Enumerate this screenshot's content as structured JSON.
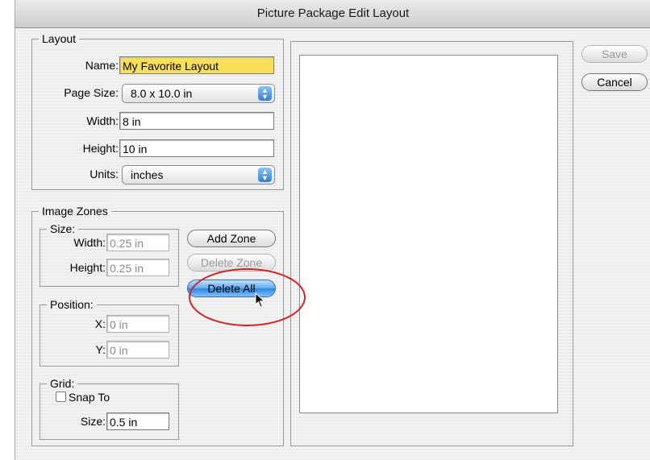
{
  "window": {
    "title": "Picture Package Edit Layout"
  },
  "layout_group": {
    "title": "Layout",
    "name_label": "Name:",
    "name_value": "My Favorite Layout",
    "page_size_label": "Page Size:",
    "page_size_value": "8.0 x 10.0 in",
    "width_label": "Width:",
    "width_value": "8 in",
    "height_label": "Height:",
    "height_value": "10 in",
    "units_label": "Units:",
    "units_value": "inches"
  },
  "image_zones": {
    "title": "Image Zones",
    "size_title": "Size:",
    "width_label": "Width:",
    "width_value": "0.25 in",
    "height_label": "Height:",
    "height_value": "0.25 in",
    "add_zone": "Add Zone",
    "delete_zone": "Delete Zone",
    "delete_all": "Delete All",
    "position_title": "Position:",
    "x_label": "X:",
    "x_value": "0 in",
    "y_label": "Y:",
    "y_value": "0 in",
    "grid_title": "Grid:",
    "snap_to": "Snap To",
    "grid_size_label": "Size:",
    "grid_size_value": "0.5 in"
  },
  "actions": {
    "save": "Save",
    "cancel": "Cancel"
  },
  "colors": {
    "highlight_field": "#f9e05a",
    "annotation_circle": "#d42020",
    "aqua_button": "#2d86e0"
  }
}
